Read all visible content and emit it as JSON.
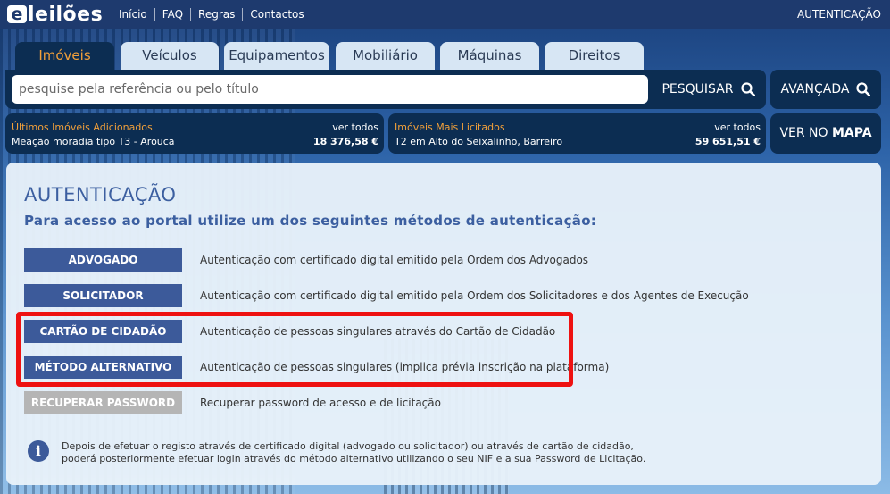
{
  "brand": {
    "logo_letter": "e",
    "logo_text": "leilões"
  },
  "topnav": {
    "items": [
      "Início",
      "FAQ",
      "Regras",
      "Contactos"
    ],
    "auth_label": "AUTENTICAÇÃO"
  },
  "tabs": [
    "Imóveis",
    "Veículos",
    "Equipamentos",
    "Mobiliário",
    "Máquinas",
    "Direitos"
  ],
  "search": {
    "placeholder": "pesquise pela referência ou pelo título",
    "button_label": "PESQUISAR",
    "advanced_label": "AVANÇADA"
  },
  "recent": {
    "title": "Últimos Imóveis Adicionados",
    "see_all": "ver todos",
    "item": "Meação moradia tipo T3 - Arouca",
    "price": "18 376,58 €"
  },
  "most_bid": {
    "title": "Imóveis Mais Licitados",
    "see_all": "ver todos",
    "item": "T2 em Alto do Seixalinho, Barreiro",
    "price": "59 651,51 €"
  },
  "map": {
    "label_pre": "VER NO ",
    "label_bold": "MAPA"
  },
  "auth": {
    "title": "AUTENTICAÇÃO",
    "subtitle": "Para acesso ao portal utilize um dos seguintes métodos de autenticação:",
    "methods": [
      {
        "label": "ADVOGADO",
        "desc": "Autenticação com certificado digital emitido pela Ordem dos Advogados"
      },
      {
        "label": "SOLICITADOR",
        "desc": "Autenticação com certificado digital emitido pela Ordem dos Solicitadores e dos Agentes de Execução"
      },
      {
        "label": "CARTÃO DE CIDADÃO",
        "desc": "Autenticação de pessoas singulares através do Cartão de Cidadão"
      },
      {
        "label": "MÉTODO ALTERNATIVO",
        "desc": "Autenticação de pessoas singulares (implica prévia inscrição na plataforma)"
      },
      {
        "label": "RECUPERAR PASSWORD",
        "desc": "Recuperar password de acesso e de licitação"
      }
    ],
    "note_line1": "Depois de efetuar o registo através de certificado digital (advogado ou solicitador) ou através de cartão de cidadão,",
    "note_line2": "poderá posteriormente efetuar login através do método alternativo utilizando o seu NIF e a sua Password de Licitação."
  },
  "colors": {
    "navy": "#0c2d52",
    "accent": "#f2a03a",
    "button_blue": "#3c5a9a",
    "highlight_red": "#ee1111"
  }
}
